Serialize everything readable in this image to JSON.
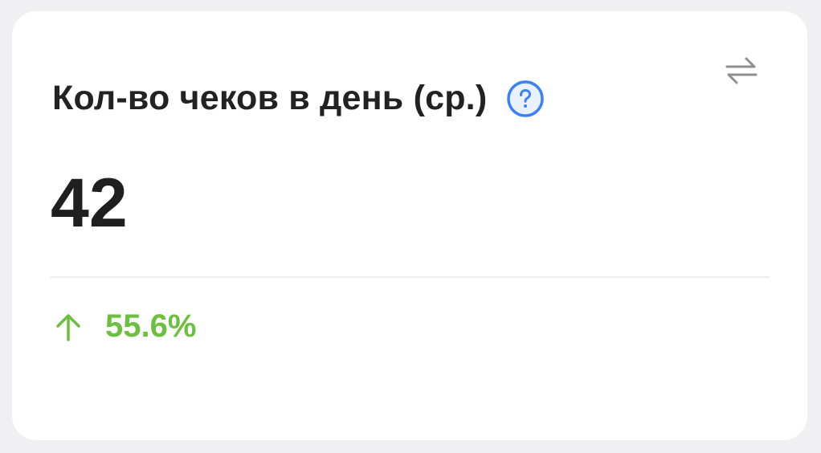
{
  "card": {
    "title": "Кол-во чеков в день (ср.)",
    "value": "42",
    "change": {
      "direction": "up",
      "text": "55.6%"
    }
  },
  "icons": {
    "help": "question-circle-icon",
    "swap": "swap-arrows-icon",
    "trend": "arrow-up-icon"
  },
  "colors": {
    "accent_blue": "#3b82f6",
    "positive_green": "#6cbf3f",
    "icon_gray": "#8e8e93"
  }
}
